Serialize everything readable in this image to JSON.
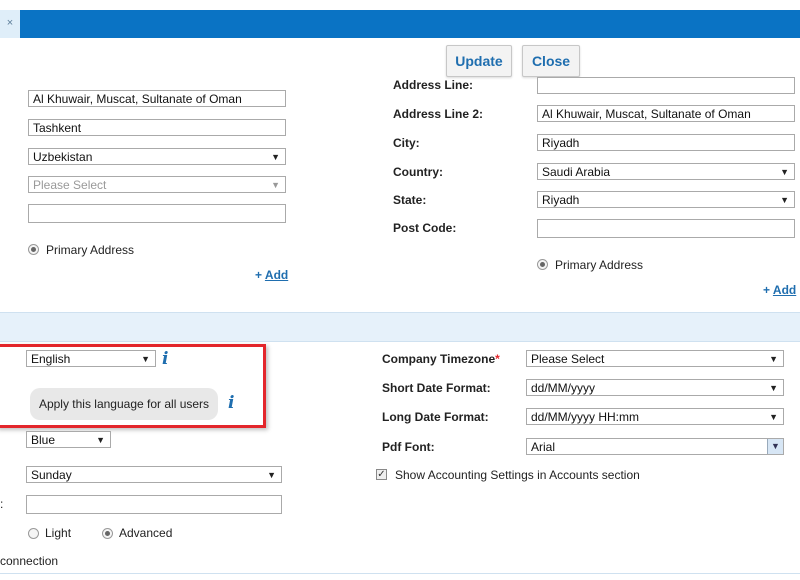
{
  "header": {
    "close_tab": "×"
  },
  "toolbar": {
    "update_label": "Update",
    "close_label": "Close"
  },
  "left_address": {
    "address_line_2": "Al Khuwair, Muscat, Sultanate of Oman",
    "city": "Tashkent",
    "country": "Uzbekistan",
    "state_placeholder": "Please Select",
    "post_code": "",
    "primary_label": "Primary Address",
    "add_plus": "+",
    "add_label": "Add"
  },
  "right_address": {
    "labels": {
      "address_line": "Address Line:",
      "address_line_2": "Address Line 2:",
      "city": "City:",
      "country": "Country:",
      "state": "State:",
      "post_code": "Post Code:"
    },
    "address_line": "",
    "address_line_2": "Al Khuwair, Muscat, Sultanate of Oman",
    "city": "Riyadh",
    "country": "Saudi Arabia",
    "state": "Riyadh",
    "post_code": "",
    "primary_label": "Primary Address",
    "add_plus": "+",
    "add_label": "Add"
  },
  "settings": {
    "language": "English",
    "tooltip": "Apply this language for all users",
    "theme": "Blue",
    "week_start": "Sunday",
    "colon_fragment": ":",
    "empty_field": "",
    "mode_light": "Light",
    "mode_advanced": "Advanced",
    "connection_fragment": "connection",
    "company_timezone_label": "Company Timezone",
    "required_mark": "*",
    "company_timezone": "Please Select",
    "short_date_label": "Short Date Format:",
    "short_date": "dd/MM/yyyy",
    "long_date_label": "Long Date Format:",
    "long_date": "dd/MM/yyyy HH:mm",
    "pdf_font_label": "Pdf Font:",
    "pdf_font": "Arial",
    "show_accounting_label": "Show Accounting Settings in Accounts section",
    "info_glyph": "i"
  },
  "colors": {
    "header_blue": "#0a73c4",
    "link_blue": "#1f6eaf",
    "highlight_red": "#e3262b",
    "band": "#e6f1fa"
  },
  "icons": [
    "close-icon",
    "dropdown-caret-icon",
    "info-icon",
    "checkbox-checked-icon",
    "radio-icon"
  ]
}
